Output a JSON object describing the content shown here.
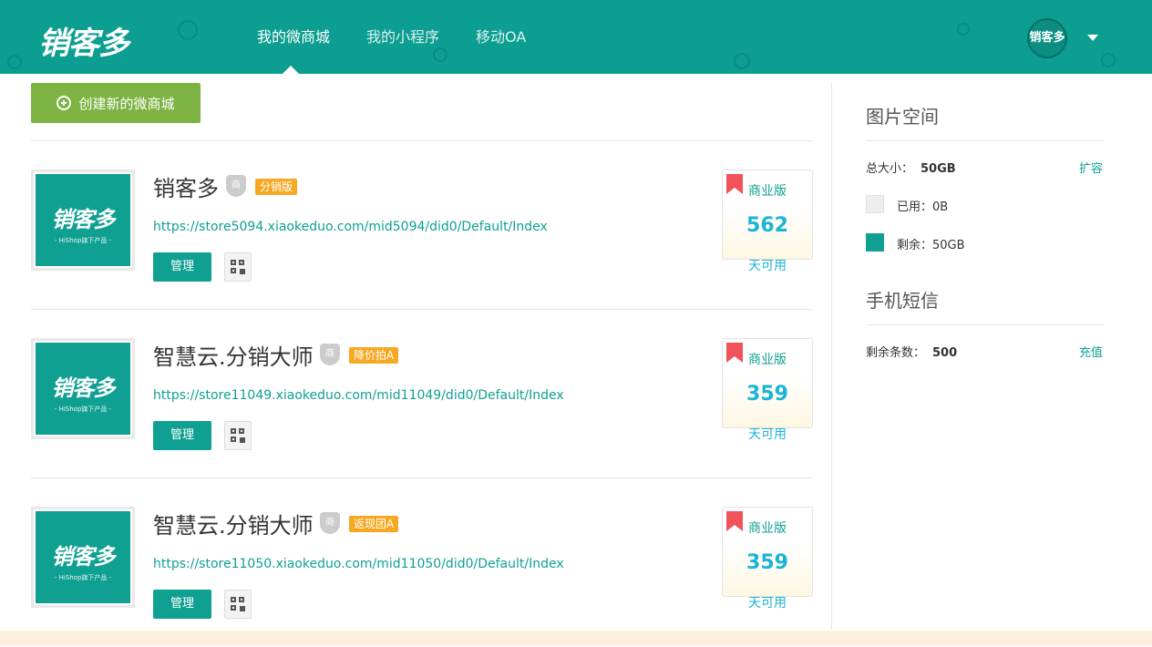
{
  "header": {
    "logo": "销客多",
    "nav": [
      {
        "label": "我的微商城",
        "active": true
      },
      {
        "label": "我的小程序",
        "active": false
      },
      {
        "label": "移动OA",
        "active": false
      }
    ],
    "avatar_text": "销客多"
  },
  "create_button": {
    "label": "创建新的微商城"
  },
  "stores": [
    {
      "name": "销客多",
      "badge": "商",
      "tag": "分销版",
      "url": "https://store5094.xiaokeduo.com/mid5094/did0/Default/Index",
      "thumb_title": "销客多",
      "thumb_sub": "- HiShop旗下产品 -",
      "manage": "管理",
      "edition": "商业版",
      "days": "562",
      "days_label": "天可用"
    },
    {
      "name": "智慧云.分销大师",
      "badge": "商",
      "tag": "降价拍A",
      "url": "https://store11049.xiaokeduo.com/mid11049/did0/Default/Index",
      "thumb_title": "销客多",
      "thumb_sub": "- HiShop旗下产品 -",
      "manage": "管理",
      "edition": "商业版",
      "days": "359",
      "days_label": "天可用"
    },
    {
      "name": "智慧云.分销大师",
      "badge": "商",
      "tag": "返现团A",
      "url": "https://store11050.xiaokeduo.com/mid11050/did0/Default/Index",
      "thumb_title": "销客多",
      "thumb_sub": "- HiShop旗下产品 -",
      "manage": "管理",
      "edition": "商业版",
      "days": "359",
      "days_label": "天可用"
    }
  ],
  "sidebar": {
    "image_space": {
      "title": "图片空间",
      "total_label": "总大小：",
      "total_value": "50GB",
      "expand_link": "扩容",
      "used": "已用：0B",
      "remaining": "剩余：50GB",
      "used_color": "#eeeeee",
      "remaining_color": "#10a092"
    },
    "sms": {
      "title": "手机短信",
      "remaining_label": "剩余条数：",
      "remaining_value": "500",
      "recharge_link": "充值"
    }
  }
}
